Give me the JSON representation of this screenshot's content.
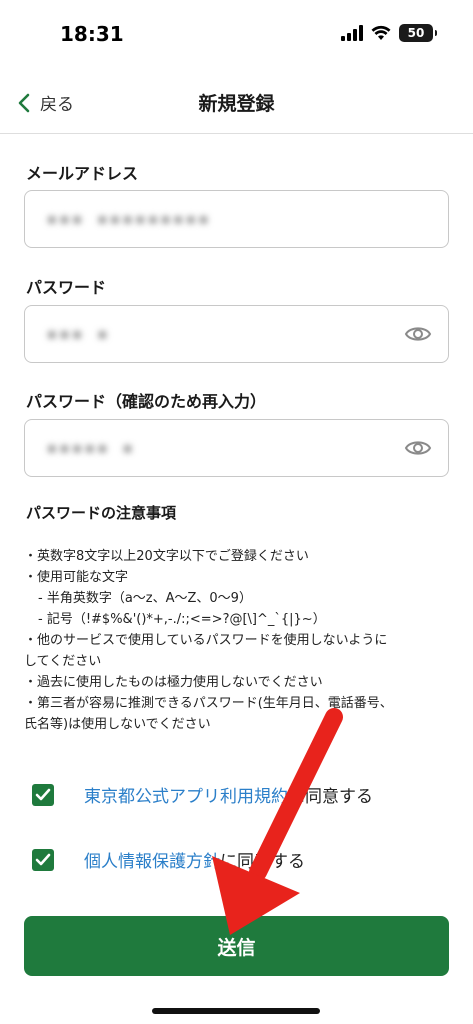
{
  "status_bar": {
    "time": "18:31",
    "battery": "50"
  },
  "nav": {
    "back_label": "戻る",
    "title": "新規登録"
  },
  "form": {
    "email": {
      "label": "メールアドレス",
      "value": "▪▪▪ ▪▪▪▪▪▪▪▪▪"
    },
    "password": {
      "label": "パスワード",
      "value": "▪▪▪ ▪"
    },
    "password_confirm": {
      "label": "パスワード（確認のため再入力）",
      "value": "▪▪▪▪▪ ▪"
    }
  },
  "notes": {
    "title": "パスワードの注意事項",
    "items": [
      "・英数字8文字以上20文字以下でご登録ください",
      "・使用可能な文字",
      "- 半角英数字（a〜z、A〜Z、0〜9）",
      "- 記号（!#$%&'()*+,-./:;<=>?@[\\]^_`{|}~）",
      "・他のサービスで使用しているパスワードを使用しないように",
      "してください",
      "・過去に使用したものは極力使用しないでください",
      "・第三者が容易に推測できるパスワード(生年月日、電話番号、",
      "氏名等)は使用しないでください"
    ]
  },
  "agreements": {
    "terms_link": "東京都公式アプリ利用規約",
    "terms_suffix": "に同意する",
    "privacy_link": "個人情報保護方針",
    "privacy_suffix": "に同意する"
  },
  "submit_label": "送信",
  "colors": {
    "primary": "#1f7a3d",
    "link": "#2b7fc9",
    "annotation_arrow": "#e8231c"
  },
  "icons": [
    "signal-icon",
    "wifi-icon",
    "battery-icon",
    "chevron-left-icon",
    "eye-icon",
    "check-icon",
    "annotation-arrow"
  ]
}
